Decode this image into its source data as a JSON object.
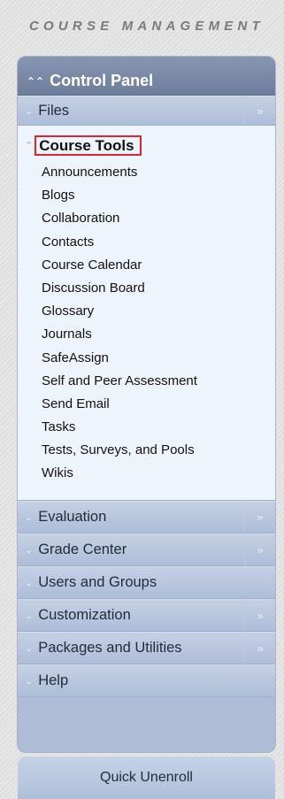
{
  "section_title": "COURSE MANAGEMENT",
  "control_panel": {
    "title": "Control Panel",
    "files": "Files",
    "course_tools": {
      "title": "Course Tools",
      "items": [
        "Announcements",
        "Blogs",
        "Collaboration",
        "Contacts",
        "Course Calendar",
        "Discussion Board",
        "Glossary",
        "Journals",
        "SafeAssign",
        "Self and Peer Assessment",
        "Send Email",
        "Tasks",
        "Tests, Surveys, and Pools",
        "Wikis"
      ]
    },
    "evaluation": "Evaluation",
    "grade_center": "Grade Center",
    "users_groups": "Users and Groups",
    "customization": "Customization",
    "packages": "Packages and Utilities",
    "help": "Help"
  },
  "quick_unenroll": "Quick Unenroll",
  "icons": {
    "collapse": "double-chevron-up-icon",
    "expand_down": "double-chevron-down-icon",
    "expand_right": "double-chevron-right-icon"
  }
}
